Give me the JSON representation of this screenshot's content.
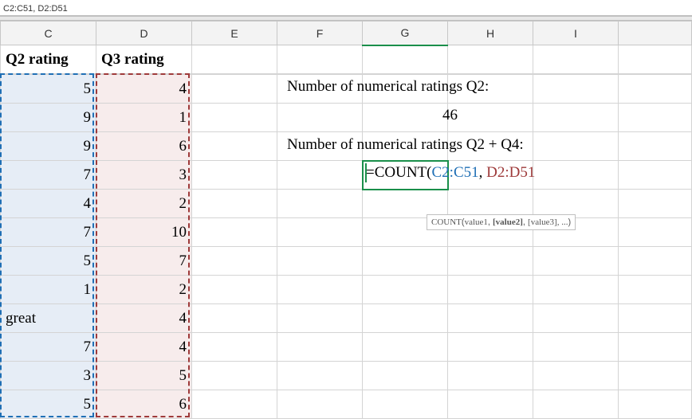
{
  "refbar": "C2:C51, D2:D51",
  "columns": [
    "C",
    "D",
    "E",
    "F",
    "G",
    "H",
    "I",
    ""
  ],
  "headers": {
    "c": "Q2 rating",
    "d": "Q3 rating"
  },
  "rows": [
    {
      "c": "5",
      "d": "4",
      "ct": "num",
      "dt": "num"
    },
    {
      "c": "9",
      "d": "1",
      "ct": "num",
      "dt": "num"
    },
    {
      "c": "9",
      "d": "6",
      "ct": "num",
      "dt": "num"
    },
    {
      "c": "7",
      "d": "3",
      "ct": "num",
      "dt": "num"
    },
    {
      "c": "4",
      "d": "2",
      "ct": "num",
      "dt": "num"
    },
    {
      "c": "7",
      "d": "10",
      "ct": "num",
      "dt": "num"
    },
    {
      "c": "5",
      "d": "7",
      "ct": "num",
      "dt": "num"
    },
    {
      "c": "1",
      "d": "2",
      "ct": "num",
      "dt": "num"
    },
    {
      "c": "great",
      "d": "4",
      "ct": "txt",
      "dt": "num"
    },
    {
      "c": "7",
      "d": "4",
      "ct": "num",
      "dt": "num"
    },
    {
      "c": "3",
      "d": "5",
      "ct": "num",
      "dt": "num"
    },
    {
      "c": "5",
      "d": "6",
      "ct": "num",
      "dt": "num"
    }
  ],
  "labels": {
    "lbl1": "Number of numerical ratings Q2:",
    "val1": "46",
    "lbl2": "Number of numerical ratings Q2 + Q4:"
  },
  "formula": {
    "eq": "=",
    "fn": "COUNT",
    "open": "(",
    "r1": "C2:C51",
    "comma": ", ",
    "r2": "D2:D51"
  },
  "tooltip": {
    "fn": "COUNT",
    "a1": "value1",
    "a2": "[value2]",
    "a3": "[value3]",
    "tail": ", ..."
  }
}
